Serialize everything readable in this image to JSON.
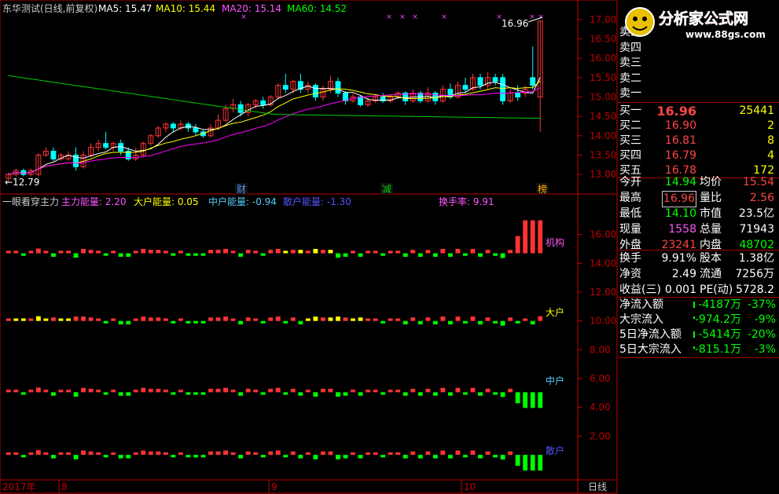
{
  "colors": {
    "up": "#ff3333",
    "down": "#00ffff",
    "ma5": "#ffffff",
    "ma10": "#ffff00",
    "ma20": "#ff00ff",
    "ma60": "#00cc00",
    "axis": "#c00000",
    "green": "#00ff00",
    "yellow": "#ffff00",
    "cyan": "#55ccff",
    "magenta": "#ff55ff",
    "value_red": "#ff4444"
  },
  "main_header": {
    "title": "东华测试(日线,前复权)",
    "ma5": "MA5: 15.47",
    "ma10": "MA10: 15.44",
    "ma20": "MA20: 15.14",
    "ma60": "MA60: 14.52"
  },
  "price_axis": {
    "ticks": [
      "17.00",
      "16.50",
      "16.00",
      "15.50",
      "15.00",
      "14.50",
      "14.00",
      "13.50",
      "13.00"
    ],
    "min": 12.8,
    "max": 17.2
  },
  "price_annotations": {
    "high": "16.96",
    "low": "←12.79"
  },
  "event_markers": [
    "财",
    "减",
    "榜"
  ],
  "ind_header": {
    "title": "一眼看穿主力",
    "main": "主力能量: 2.20",
    "big": "大户能量: 0.05",
    "mid": "中户能量: -0.94",
    "retail": "散户能量: -1.30",
    "turnover": "换手率: 9.91"
  },
  "ind_axis": {
    "ticks": [
      "16.00",
      "14.00",
      "12.00",
      "10.00",
      "8.00",
      "6.00",
      "4.00",
      "2.00"
    ]
  },
  "ind_labels": {
    "inst": "机构",
    "big": "大户",
    "mid": "中户",
    "retail": "散户"
  },
  "date_axis": {
    "labels": [
      "2017年",
      "8",
      "9",
      "10"
    ],
    "period": "日线"
  },
  "chart_data": {
    "type": "candlestick",
    "n_bars": 70,
    "candles": [
      [
        12.9,
        13.0,
        12.79,
        13.05
      ],
      [
        13.0,
        13.1,
        12.95,
        13.15
      ],
      [
        13.1,
        13.0,
        12.95,
        13.15
      ],
      [
        13.0,
        13.1,
        12.95,
        13.15
      ],
      [
        13.0,
        13.5,
        12.95,
        13.55
      ],
      [
        13.5,
        13.6,
        13.45,
        13.7
      ],
      [
        13.6,
        13.4,
        13.35,
        13.7
      ],
      [
        13.4,
        13.5,
        13.35,
        13.55
      ],
      [
        13.4,
        13.5,
        13.35,
        13.6
      ],
      [
        13.5,
        13.2,
        13.1,
        13.7
      ],
      [
        13.2,
        13.5,
        13.15,
        13.6
      ],
      [
        13.5,
        13.7,
        13.45,
        13.8
      ],
      [
        13.7,
        13.8,
        13.6,
        13.9
      ],
      [
        13.8,
        13.7,
        13.65,
        14.1
      ],
      [
        13.7,
        13.8,
        13.6,
        13.85
      ],
      [
        13.8,
        13.6,
        13.5,
        13.9
      ],
      [
        13.6,
        13.4,
        13.35,
        13.7
      ],
      [
        13.4,
        13.5,
        13.35,
        13.7
      ],
      [
        13.5,
        13.8,
        13.45,
        13.85
      ],
      [
        13.8,
        14.0,
        13.75,
        14.05
      ],
      [
        14.0,
        14.2,
        13.95,
        14.25
      ],
      [
        14.2,
        14.3,
        14.1,
        14.35
      ],
      [
        14.3,
        14.2,
        14.1,
        14.35
      ],
      [
        14.2,
        14.3,
        14.15,
        14.4
      ],
      [
        14.3,
        14.2,
        14.1,
        14.35
      ],
      [
        14.2,
        14.1,
        14.0,
        14.3
      ],
      [
        14.1,
        14.0,
        13.95,
        14.15
      ],
      [
        14.0,
        14.2,
        13.95,
        14.3
      ],
      [
        14.2,
        14.4,
        14.15,
        14.55
      ],
      [
        14.4,
        14.7,
        14.35,
        14.8
      ],
      [
        14.7,
        14.8,
        14.6,
        14.95
      ],
      [
        14.8,
        14.6,
        14.5,
        14.9
      ],
      [
        14.6,
        14.8,
        14.5,
        14.85
      ],
      [
        14.8,
        14.9,
        14.7,
        14.95
      ],
      [
        14.9,
        14.8,
        14.7,
        15.0
      ],
      [
        14.8,
        15.0,
        14.75,
        15.05
      ],
      [
        15.0,
        15.3,
        14.95,
        15.35
      ],
      [
        15.3,
        15.2,
        15.1,
        15.6
      ],
      [
        15.2,
        15.4,
        15.1,
        15.45
      ],
      [
        15.4,
        15.2,
        15.1,
        15.6
      ],
      [
        15.2,
        15.3,
        15.1,
        15.4
      ],
      [
        15.3,
        15.0,
        14.9,
        15.35
      ],
      [
        15.0,
        15.2,
        14.9,
        15.3
      ],
      [
        15.2,
        15.4,
        15.1,
        15.55
      ],
      [
        15.4,
        15.1,
        15.0,
        15.5
      ],
      [
        15.1,
        14.9,
        14.8,
        15.15
      ],
      [
        14.9,
        15.0,
        14.85,
        15.1
      ],
      [
        15.0,
        14.8,
        14.75,
        15.05
      ],
      [
        14.8,
        14.9,
        14.75,
        15.0
      ],
      [
        14.9,
        15.0,
        14.85,
        15.05
      ],
      [
        15.0,
        14.9,
        14.85,
        15.1
      ],
      [
        14.9,
        15.0,
        14.85,
        15.05
      ],
      [
        15.0,
        15.1,
        14.95,
        15.15
      ],
      [
        15.1,
        14.9,
        14.8,
        15.15
      ],
      [
        14.9,
        15.1,
        14.85,
        15.2
      ],
      [
        15.1,
        14.9,
        14.85,
        15.15
      ],
      [
        14.9,
        15.1,
        14.85,
        15.25
      ],
      [
        15.1,
        14.9,
        14.8,
        15.15
      ],
      [
        14.9,
        15.2,
        14.85,
        15.3
      ],
      [
        15.2,
        15.0,
        14.95,
        15.35
      ],
      [
        15.0,
        15.3,
        14.95,
        15.4
      ],
      [
        15.3,
        15.2,
        15.1,
        15.5
      ],
      [
        15.2,
        15.5,
        15.15,
        15.6
      ],
      [
        15.5,
        15.3,
        15.2,
        15.6
      ],
      [
        15.3,
        15.5,
        15.2,
        15.65
      ],
      [
        15.5,
        15.4,
        15.3,
        15.6
      ],
      [
        15.5,
        14.9,
        14.8,
        15.6
      ],
      [
        14.9,
        15.1,
        14.85,
        15.2
      ],
      [
        15.1,
        15.0,
        14.9,
        15.3
      ],
      [
        15.1,
        15.2,
        15.0,
        15.3
      ],
      [
        15.5,
        15.3,
        15.2,
        16.3
      ],
      [
        15.0,
        16.96,
        14.1,
        16.96
      ]
    ]
  },
  "quote": {
    "sells": [
      {
        "label": "卖五",
        "price": "",
        "vol": ""
      },
      {
        "label": "卖四",
        "price": "",
        "vol": ""
      },
      {
        "label": "卖三",
        "price": "",
        "vol": ""
      },
      {
        "label": "卖二",
        "price": "",
        "vol": ""
      },
      {
        "label": "卖一",
        "price": "",
        "vol": ""
      }
    ],
    "buys": [
      {
        "label": "买一",
        "price": "16.96",
        "vol": "25441"
      },
      {
        "label": "买二",
        "price": "16.90",
        "vol": "2"
      },
      {
        "label": "买三",
        "price": "16.81",
        "vol": "8"
      },
      {
        "label": "买四",
        "price": "16.79",
        "vol": "4"
      },
      {
        "label": "买五",
        "price": "16.78",
        "vol": "172"
      }
    ],
    "stats": [
      [
        {
          "l": "今开",
          "v": "14.94",
          "c": "green"
        },
        {
          "l": "均价",
          "v": "15.54",
          "c": "red"
        }
      ],
      [
        {
          "l": "最高",
          "v": "16.96",
          "c": "red"
        },
        {
          "l": "量比",
          "v": "2.56",
          "c": "red"
        }
      ],
      [
        {
          "l": "最低",
          "v": "14.10",
          "c": "green"
        },
        {
          "l": "市值",
          "v": "23.5亿",
          "c": "white"
        }
      ],
      [
        {
          "l": "现量",
          "v": "1558",
          "c": "magenta"
        },
        {
          "l": "总量",
          "v": "71943",
          "c": "white"
        }
      ],
      [
        {
          "l": "外盘",
          "v": "23241",
          "c": "red"
        },
        {
          "l": "内盘",
          "v": "48702",
          "c": "green"
        }
      ]
    ],
    "fund": [
      [
        {
          "l": "换手",
          "v": "9.91%"
        },
        {
          "l": "股本",
          "v": "1.38亿"
        }
      ],
      [
        {
          "l": "净资",
          "v": "2.49"
        },
        {
          "l": "流通",
          "v": "7256万"
        }
      ],
      [
        {
          "l": "收益(三)",
          "v": "0.001"
        },
        {
          "l": "PE(动)",
          "v": "5728.2"
        }
      ]
    ],
    "flows": [
      {
        "l": "净流入额",
        "v": "-4187万",
        "p": "-37%"
      },
      {
        "l": "大宗流入",
        "v": "-974.2万",
        "p": "-9%"
      },
      {
        "l": "5日净流入额",
        "v": "-5414万",
        "p": "-20%"
      },
      {
        "l": "5日大宗流入",
        "v": "-815.1万",
        "p": "-3%"
      }
    ]
  },
  "logo": {
    "text": "分析家公式网",
    "url": "www.88gs.com"
  }
}
